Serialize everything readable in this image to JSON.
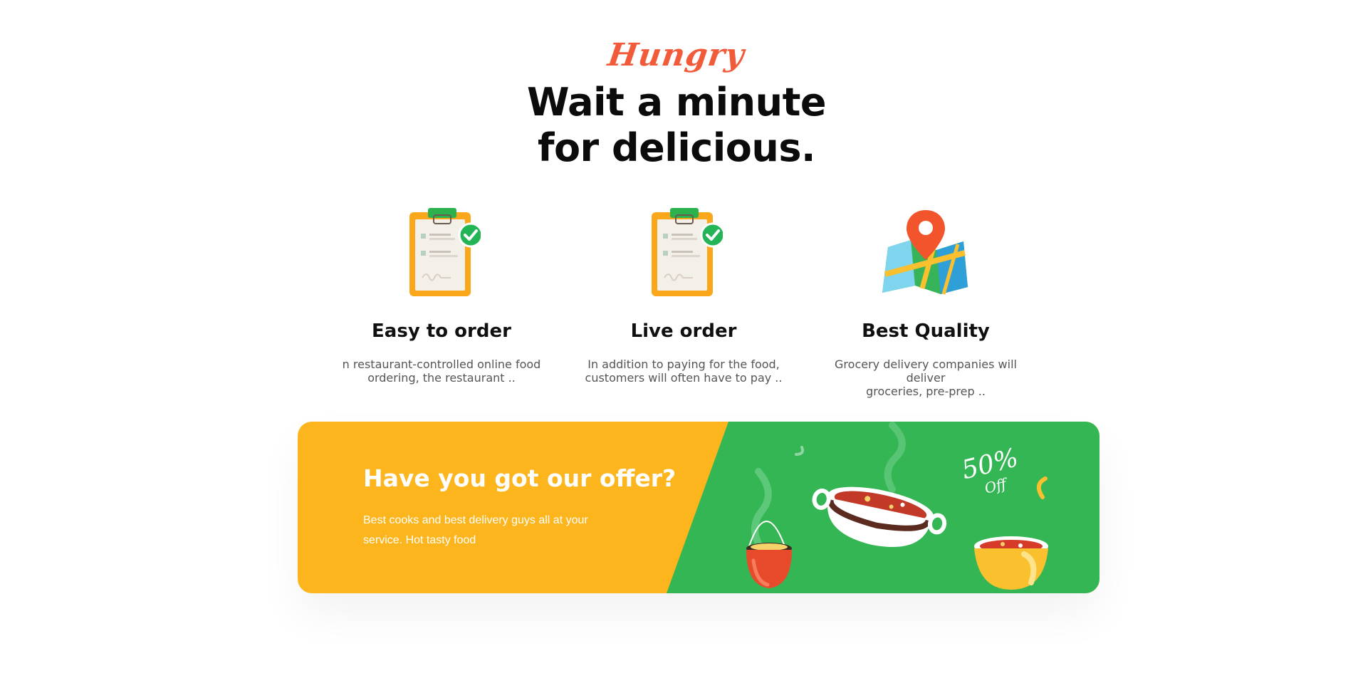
{
  "header": {
    "script_title": "Hungry",
    "headline_line1": "Wait a minute",
    "headline_line2": "for delicious."
  },
  "features": [
    {
      "icon": "clipboard-check-icon",
      "title": "Easy to order",
      "description_line1": "n restaurant-controlled online food",
      "description_line2": "ordering, the restaurant .."
    },
    {
      "icon": "clipboard-check-icon",
      "title": "Live order",
      "description_line1": "In addition to paying for the food,",
      "description_line2": "customers will often have to pay .."
    },
    {
      "icon": "map-pin-icon",
      "title": "Best Quality",
      "description_line1": "Grocery delivery companies will deliver",
      "description_line2": "groceries, pre-prep .."
    }
  ],
  "offer": {
    "title": "Have you got our offer?",
    "description": "Best cooks and best delivery guys all at your service. Hot tasty food",
    "badge_percent": "50%",
    "badge_label": "Off"
  },
  "colors": {
    "accent_script": "#f25b3a",
    "offer_yellow": "#fdb51d",
    "offer_green": "#35b654",
    "clipboard_orange": "#fba71b",
    "check_green": "#22b455"
  }
}
